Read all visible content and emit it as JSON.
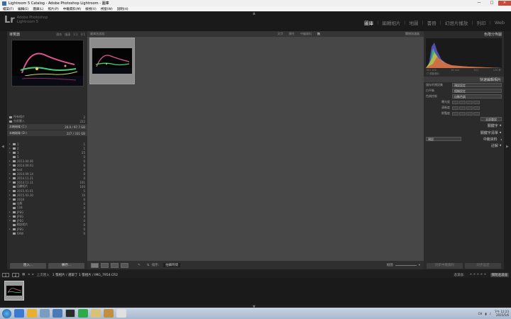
{
  "window": {
    "title": "Lightroom 5 Catalog - Adobe Photoshop Lightroom - 圖庫",
    "controls": [
      "—",
      "□",
      "✕"
    ]
  },
  "menu": [
    "檔案(F)",
    "編輯(E)",
    "圖庫(L)",
    "照片(P)",
    "中繼資料(M)",
    "檢視(V)",
    "視窗(W)",
    "說明(H)"
  ],
  "identity": {
    "logo": "Lr",
    "product": "Adobe Photoshop",
    "version": "Lightroom 5",
    "modules": [
      {
        "label": "圖庫",
        "active": true
      },
      {
        "label": "編輯相片",
        "active": false
      },
      {
        "label": "地圖",
        "active": false
      },
      {
        "label": "書冊",
        "active": false
      },
      {
        "label": "幻燈片播放",
        "active": false
      },
      {
        "label": "列印",
        "active": false
      },
      {
        "label": "Web",
        "active": false
      }
    ]
  },
  "navigator": {
    "title": "導覽器",
    "options": [
      "適合",
      "填滿",
      "1:1",
      "3:1"
    ]
  },
  "catalog": [
    {
      "label": "所有相片",
      "count": "2"
    },
    {
      "label": "先前匯入",
      "count": "222"
    }
  ],
  "folders_header": {
    "label": "本機磁碟 (C:)",
    "stats": "26.0 / 97.7 GB"
  },
  "folders_header2": {
    "label": "本機磁碟 (D:)",
    "stats": "227 / 331 GB"
  },
  "folders": [
    {
      "label": "1",
      "count": "1"
    },
    {
      "label": "2",
      "count": "1"
    },
    {
      "label": "3",
      "count": "25"
    },
    {
      "label": "5",
      "count": "0"
    },
    {
      "label": "2013.04.06",
      "count": "0"
    },
    {
      "label": "2014.09.03",
      "count": "0"
    },
    {
      "label": "test",
      "count": "0"
    },
    {
      "label": "2014.09.14",
      "count": "0"
    },
    {
      "label": "2014.11.21",
      "count": "0"
    },
    {
      "label": "2014.11.11",
      "count": "101"
    },
    {
      "label": "回饋相片",
      "count": "100"
    },
    {
      "label": "2015.01.01",
      "count": "5"
    },
    {
      "label": "2015.03.30",
      "count": "16"
    },
    {
      "label": "2016",
      "count": "0"
    },
    {
      "label": "山脈",
      "count": "0"
    },
    {
      "label": "日本",
      "count": "0"
    },
    {
      "label": "JPEG",
      "count": "4"
    },
    {
      "label": "JPEG",
      "count": "4"
    },
    {
      "label": "JPEG",
      "count": "0"
    },
    {
      "label": "網誌相片",
      "count": "0"
    },
    {
      "label": "JPEG",
      "count": "0"
    },
    {
      "label": "RAW",
      "count": "0"
    }
  ],
  "left_buttons": {
    "import": "匯入...",
    "export": "轉存..."
  },
  "filter_bar": {
    "title": "圖庫過濾器：",
    "options": [
      {
        "label": "文字",
        "on": false
      },
      {
        "label": "屬性",
        "on": false
      },
      {
        "label": "中繼資料",
        "on": false
      },
      {
        "label": "無",
        "on": true
      }
    ],
    "custom": "關閉過濾器"
  },
  "toolbar": {
    "sort_label": "排序：",
    "sort_value": "拍攝時間",
    "thumb_label": "縮圖"
  },
  "histogram": {
    "title": "色階分佈圖",
    "info": [
      "ISO 100",
      "16 mm",
      "f/22",
      "120 秒"
    ],
    "original": "原始相片"
  },
  "quick_develop": {
    "title": "快速編輯相片",
    "preset_key": "儲存的預設集",
    "preset_val": "預設設定",
    "wb_key": "白平衡",
    "wb_val": "相機設定",
    "tone_key": "色調控制",
    "auto_tone": "自動色調",
    "rows": [
      "曝光度",
      "清晰度",
      "鮮豔度"
    ],
    "reset": "全部重設"
  },
  "right_sections": [
    "關鍵字",
    "關鍵字清單",
    "中繼資料",
    "註解"
  ],
  "right_default": "預設",
  "right_buttons": {
    "sync_meta": "同步中繼資料",
    "sync_settings": "同步設定"
  },
  "filmstrip": {
    "monitors": [
      "1",
      "2"
    ],
    "source": "上次匯入",
    "path": "1 張相片 / 選取了 1 張相片 / IMG_7954.CR2",
    "filter_label": "過濾器：",
    "stars": "★★★★★",
    "filter_value": "關閉過濾器"
  },
  "taskbar": {
    "time": "下午 12:23",
    "date": "2015/5/6",
    "lang": "CH"
  }
}
